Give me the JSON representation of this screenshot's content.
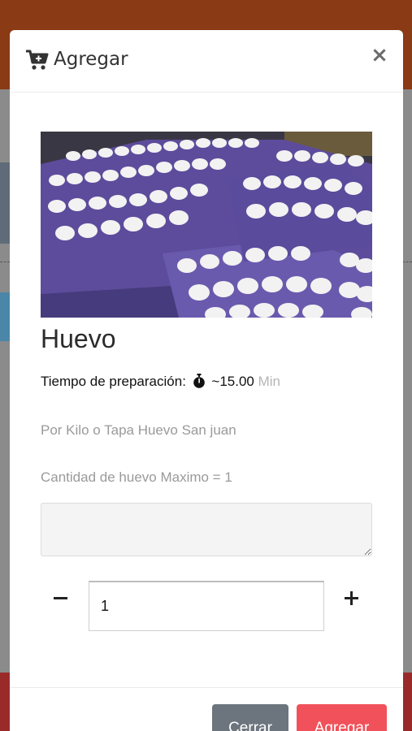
{
  "modal": {
    "title": "Agregar",
    "title_icon": "cart-plus-icon",
    "close_icon": "close-icon"
  },
  "product": {
    "image_alt": "eggs-on-trays-image",
    "name": "Huevo",
    "prep_label": "Tiempo de preparación:",
    "prep_icon": "stopwatch-icon",
    "prep_value": "~15.00",
    "prep_unit": "Min",
    "description": "Por Kilo o Tapa Huevo San juan",
    "max_quantity": "Cantidad de huevo Maximo = 1"
  },
  "notes": {
    "value": ""
  },
  "quantity": {
    "value": "1",
    "minus_icon": "minus-icon",
    "plus_icon": "plus-icon"
  },
  "footer": {
    "close_label": "Cerrar",
    "add_label": "Agregar"
  },
  "colors": {
    "header_bg": "#8a3a14",
    "close_button": "#6c757d",
    "add_button": "#f1515a",
    "footer_bg": "#9a2a2a"
  }
}
